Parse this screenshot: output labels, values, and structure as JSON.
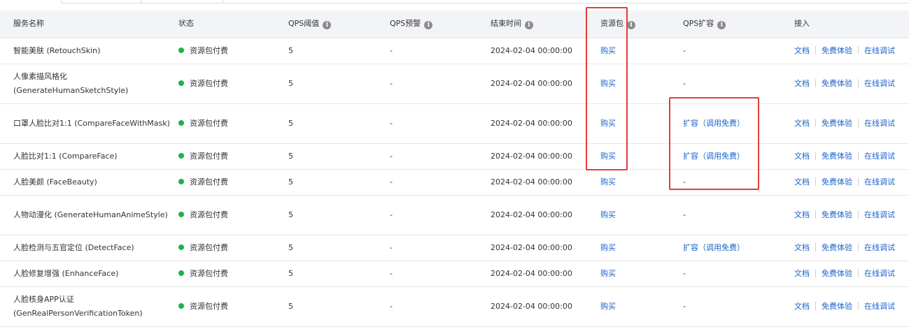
{
  "columns": {
    "name": "服务名称",
    "status": "状态",
    "qps_threshold": "QPS阈值",
    "qps_alert": "QPS预警",
    "end_time": "结束时间",
    "resource_pack": "资源包",
    "qps_expand": "QPS扩容",
    "access": "接入"
  },
  "info_glyph": "i",
  "access_links": {
    "docs": "文档",
    "trial": "免费体验",
    "debug": "在线调试"
  },
  "rows": [
    {
      "name": "智能美肤 (RetouchSkin)",
      "status": "资源包付费",
      "qps": "5",
      "alert": "-",
      "end": "2024-02-04 00:00:00",
      "pack": "购买",
      "expand": "-"
    },
    {
      "name": "人像素描风格化 (GenerateHumanSketchStyle)",
      "status": "资源包付费",
      "qps": "5",
      "alert": "-",
      "end": "2024-02-04 00:00:00",
      "pack": "购买",
      "expand": "-"
    },
    {
      "name": "口罩人脸比对1:1 (CompareFaceWithMask)",
      "status": "资源包付费",
      "qps": "5",
      "alert": "-",
      "end": "2024-02-04 00:00:00",
      "pack": "购买",
      "expand": "扩容（调用免费）"
    },
    {
      "name": "人脸比对1:1 (CompareFace)",
      "status": "资源包付费",
      "qps": "5",
      "alert": "-",
      "end": "2024-02-04 00:00:00",
      "pack": "购买",
      "expand": "扩容（调用免费）"
    },
    {
      "name": "人脸美颜 (FaceBeauty)",
      "status": "资源包付费",
      "qps": "5",
      "alert": "-",
      "end": "2024-02-04 00:00:00",
      "pack": "购买",
      "expand": "-"
    },
    {
      "name": "人物动漫化 (GenerateHumanAnimeStyle)",
      "status": "资源包付费",
      "qps": "5",
      "alert": "-",
      "end": "2024-02-04 00:00:00",
      "pack": "购买",
      "expand": "-"
    },
    {
      "name": "人脸检测与五官定位 (DetectFace)",
      "status": "资源包付费",
      "qps": "5",
      "alert": "-",
      "end": "2024-02-04 00:00:00",
      "pack": "购买",
      "expand": "扩容（调用免费）"
    },
    {
      "name": "人脸修复增强 (EnhanceFace)",
      "status": "资源包付费",
      "qps": "5",
      "alert": "-",
      "end": "2024-02-04 00:00:00",
      "pack": "购买",
      "expand": "-"
    },
    {
      "name": "人脸核身APP认证 (GenRealPersonVerificationToken)",
      "status": "资源包付费",
      "qps": "5",
      "alert": "-",
      "end": "2024-02-04 00:00:00",
      "pack": "购买",
      "expand": "-"
    }
  ],
  "colors": {
    "accent_link": "#1a62c8",
    "status_green": "#1fb24a",
    "highlight_red": "#e83a3a",
    "header_bg": "#f2f4f7"
  }
}
